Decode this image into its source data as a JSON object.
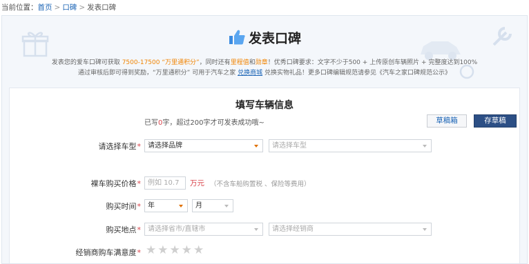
{
  "breadcrumb": {
    "prefix": "当前位置：",
    "items": [
      "首页",
      "口碑",
      "发表口碑"
    ],
    "separator": ">"
  },
  "header": {
    "title": "发表口碑",
    "desc1": {
      "a": "发表您的爱车口碑可获取 ",
      "range": "7500-17500",
      "b": " “万里通积分”",
      "c": "，同时还有",
      "d": "里程值",
      "e": "和",
      "f": "勋章",
      "g": "！优秀口碑要求：文字不少于500 + 上传原创车辆照片 + 完整度达到100%"
    },
    "desc2": {
      "a": "通过审核后即可得到奖励，“万里通积分” 可用于汽车之家 ",
      "b": "兑换商城",
      "c": " 兑换实物礼品！更多口碑编辑规范请参见《汽车之家口碑规范公示》"
    }
  },
  "form": {
    "title": "填写车辆信息",
    "word_count": {
      "pre": "已写",
      "num": "0",
      "post": "字，超过200字才可发表成功哦~"
    },
    "buttons": {
      "draft": "草稿箱",
      "save": "存草稿"
    },
    "model": {
      "label": "请选择车型",
      "brand": "请选择品牌",
      "car": "请选择车型"
    },
    "price": {
      "label": "裸车购买价格",
      "placeholder": "例如 10.7",
      "unit": "万元",
      "hint": "（不含车船购置税 、保险等费用）"
    },
    "date": {
      "label": "购买时间",
      "year": "年",
      "month": "月"
    },
    "place": {
      "label": "购买地点",
      "city": "请选择省市/直辖市",
      "dealer": "请选择经销商"
    },
    "satisfaction": {
      "label": "经销商购车满意度",
      "stars": 5,
      "rating": 0
    },
    "required_mark": "*",
    "colors": {
      "accent": "#f08300",
      "link": "#1a63b5",
      "required": "#d9434a",
      "primary_button": "#2c4f85"
    }
  }
}
